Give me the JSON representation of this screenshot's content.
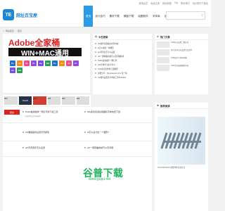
{
  "topbar": {
    "links": [
      "登录会员",
      "免费注册",
      "网站地图",
      "Tag",
      "联系我们",
      "设计软件下载站"
    ]
  },
  "header": {
    "logo_mark": "TE",
    "logo_name": "网址百宝屋",
    "logo_sub": "www.baidu.com",
    "search_icon": "search-icon"
  },
  "nav": {
    "items": [
      {
        "label": "首页",
        "active": true
      },
      {
        "label": "设计技巧",
        "active": false
      },
      {
        "label": "素材下载",
        "active": false
      },
      {
        "label": "模板下载",
        "active": false
      },
      {
        "label": "绘图软件",
        "active": false
      },
      {
        "label": "字体库",
        "active": false
      },
      {
        "label": "设计知识",
        "active": false
      }
    ]
  },
  "breadcrumb": {
    "items": [
      "网站首页",
      "首页"
    ]
  },
  "banner": {
    "title": "Adobe全家桶",
    "subtitle": "WIN+MAC通用",
    "apps": [
      {
        "label": "Ps",
        "color": "#1f6fd1"
      },
      {
        "label": "Ai",
        "color": "#f38b1f"
      },
      {
        "label": "Id",
        "color": "#e84c8b"
      },
      {
        "label": "Pr",
        "color": "#8f4be0"
      },
      {
        "label": "Ae",
        "color": "#7b4de0"
      },
      {
        "label": "Dw",
        "color": "#2b9c5e"
      },
      {
        "label": "Ps",
        "color": "#1f6fd1"
      },
      {
        "label": "Ai",
        "color": "#f38b1f"
      },
      {
        "label": "Id",
        "color": "#e84c8b"
      },
      {
        "label": "Pr",
        "color": "#8f4be0"
      },
      {
        "label": "Ae",
        "color": "#7b4de0"
      },
      {
        "label": "Dw",
        "color": "#2b9c5e"
      }
    ]
  },
  "latest": {
    "title": "今日更新",
    "items": [
      "cdr软件出现临时文件内容",
      "ai怎么做出一些图形",
      "ppt背景音乐怎么设置",
      "cdr一键转曲的技巧以及问题解决",
      "Pudio各类插件一网打尽",
      "cad字体不全是为什么",
      "CAD标注怎样将上面图形",
      "免费分享：Sprucecount v2.2 第一版",
      "cdr如何设置文字内容工具Illustrator"
    ]
  },
  "sidebar": {
    "title": "热门文章",
    "items": [
      "CAD标注设置三种方法",
      "多行文字怎么设置合成文本",
      "CAD显示与打印问题",
      "CAD怎么缩放图纸内容"
    ]
  },
  "ads": {
    "items": [
      "ad",
      "TEAM",
      "ad",
      "ad",
      "ad",
      "ad"
    ]
  },
  "feed": {
    "tag": "更多",
    "items": [
      {
        "title": "Pudio各类插件一网打尽到下载工具",
        "meta": "一款好用的实用的插件"
      },
      {
        "title": "500多款实用好用图标字体免费下载",
        "meta": ""
      },
      {
        "title": "cdr做插画时设置背景颜色",
        "meta": ""
      },
      {
        "title": "ai怎么设计出一个图形?",
        "meta": ""
      },
      {
        "title": "ppt背景音乐怎么设置",
        "meta": ""
      },
      {
        "title": "cdr一键转曲的技巧以及问题",
        "meta": ""
      }
    ]
  },
  "recommend": {
    "title": "推荐阅读",
    "caption": "SOLIDWORKS 弹簧零件绘制方法"
  },
  "watermark": {
    "title": "谷普下载",
    "subtitle": "www.gupu.net"
  }
}
